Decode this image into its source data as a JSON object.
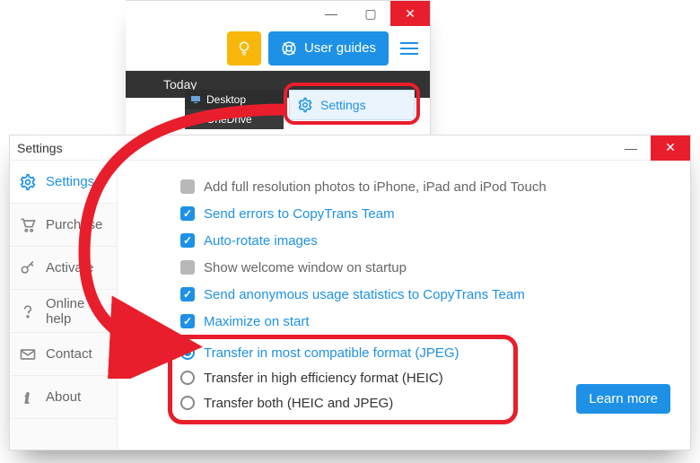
{
  "top_window": {
    "tip_glyph": "◎",
    "user_guides_label": "User guides",
    "darkrow_label": "Today",
    "locations": [
      "Desktop",
      "OneDrive"
    ],
    "dropdown_settings_label": "Settings"
  },
  "settings_window": {
    "title": "Settings",
    "sidebar": {
      "items": [
        {
          "label": "Settings",
          "active": true
        },
        {
          "label": "Purchase",
          "active": false
        },
        {
          "label": "Activate",
          "active": false
        },
        {
          "label": "Online help",
          "active": false
        },
        {
          "label": "Contact",
          "active": false
        },
        {
          "label": "About",
          "active": false
        }
      ]
    },
    "checkboxes": [
      {
        "label": "Add full resolution photos to iPhone, iPad and iPod Touch",
        "checked": false
      },
      {
        "label": "Send errors to CopyTrans Team",
        "checked": true
      },
      {
        "label": "Auto-rotate images",
        "checked": true
      },
      {
        "label": "Show welcome window on startup",
        "checked": false
      },
      {
        "label": "Send anonymous usage statistics to CopyTrans Team",
        "checked": true
      },
      {
        "label": "Maximize on start",
        "checked": true
      }
    ],
    "radios": [
      {
        "label": "Transfer in most compatible format (JPEG)",
        "selected": true
      },
      {
        "label": "Transfer in high efficiency format (HEIC)",
        "selected": false
      },
      {
        "label": "Transfer both (HEIC and JPEG)",
        "selected": false
      }
    ],
    "learn_more_label": "Learn more"
  },
  "window_controls": {
    "minimize": "—",
    "maximize": "▢",
    "close": "✕"
  },
  "colors": {
    "accent": "#1e91e6",
    "warning": "#f8b70a",
    "danger": "#e91e2c"
  }
}
